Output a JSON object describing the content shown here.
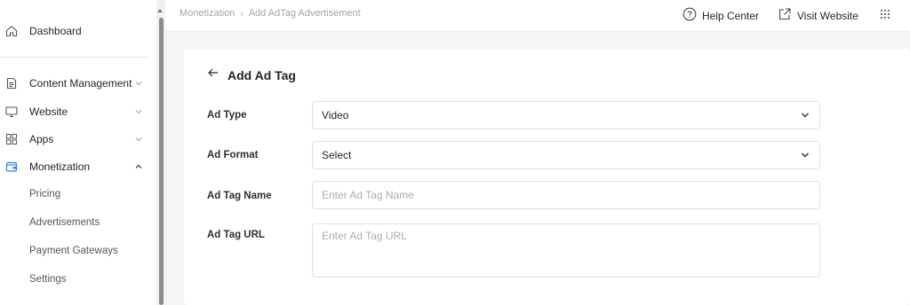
{
  "sidebar": {
    "items": [
      {
        "label": "Dashboard",
        "icon": "home-icon"
      },
      {
        "label": "Content Management",
        "icon": "document-icon"
      },
      {
        "label": "Website",
        "icon": "monitor-icon"
      },
      {
        "label": "Apps",
        "icon": "grid-icon"
      },
      {
        "label": "Monetization",
        "icon": "wallet-icon",
        "expanded": true
      }
    ],
    "sub_items": [
      "Pricing",
      "Advertisements",
      "Payment Gateways",
      "Settings"
    ]
  },
  "topbar": {
    "breadcrumb": [
      "Monetization",
      "Add AdTag Advertisement"
    ],
    "help_center": "Help Center",
    "visit_website": "Visit Website"
  },
  "form": {
    "title": "Add Ad Tag",
    "ad_type_label": "Ad Type",
    "ad_type_value": "Video",
    "ad_format_label": "Ad Format",
    "ad_format_value": "Select",
    "ad_tag_name_label": "Ad Tag Name",
    "ad_tag_name_placeholder": "Enter Ad Tag Name",
    "ad_tag_url_label": "Ad Tag URL",
    "ad_tag_url_placeholder": "Enter Ad Tag URL"
  },
  "colors": {
    "accent": "#2f80ed",
    "border": "#dcdfe4",
    "muted_text": "#a0a4aa"
  }
}
